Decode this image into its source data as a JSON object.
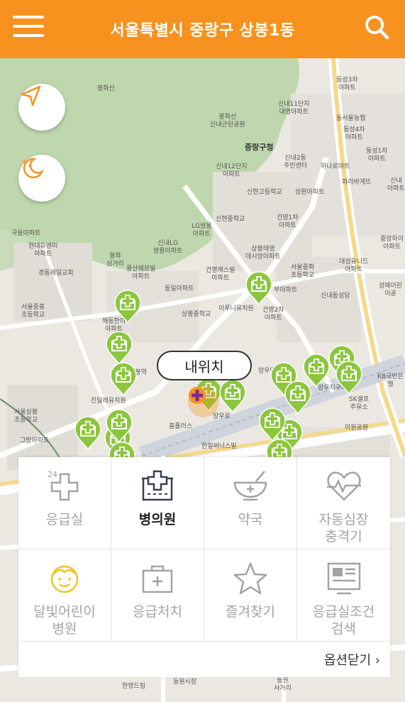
{
  "header": {
    "title": "서울특별시 중랑구 상봉1동",
    "accent": "#f7921e"
  },
  "map": {
    "my_location_label": "내위치",
    "labels": [
      "봉화산",
      "봉화산\n신내근린공원",
      "중랑구청",
      "동성3차\n아파트",
      "신내11단지\n대명아파트",
      "동서울농협",
      "동성4차\n아파트",
      "동성1차\n아파트",
      "신내2동\n주민센터",
      "신내12단지\n아파트",
      "신현고등학교",
      "성원아파트",
      "하나로마트",
      "파리바게뜨",
      "신내\n아파트",
      "LG쌍용\n아파트",
      "신현중학교",
      "건영1차\n아파트",
      "극동아파트",
      "현대휴엔미\n아파트",
      "신내LG\n쌍용아파트",
      "상봉태영\n데시앙아파트",
      "중앙하이\n아파트",
      "경동제일교회",
      "봉화\n삼거리",
      "풍산쉐르빌\n아파트",
      "건영캐스빌\n아파트",
      "서울중화\n초등학교",
      "대성유니드\n아파트",
      "성예어린이공",
      "동일아파트",
      "서울중흥\n초등학교",
      "해동한미\n아파트",
      "상봉중학교",
      "이루니유치원",
      "건영2차\n아파트",
      "부아파트",
      "신내동성당",
      "상봉역",
      "망우역",
      "KB국민은행",
      "망우지구대",
      "SK셀프\n주유소",
      "진달래유치원",
      "서울상봉\n초등학교",
      "그랑아파트",
      "홈플러스",
      "한일써너스빌",
      "미원공원",
      "망우로",
      "한영드림",
      "동원시장",
      "동원\n사거리"
    ]
  },
  "buttons": {
    "navigate": "navigate-icon",
    "night_mode": "night-mode-icon"
  },
  "panel": {
    "items": [
      {
        "label": "응급실",
        "icon": "24-hour-cross-icon",
        "active": false
      },
      {
        "label": "병의원",
        "icon": "hospital-icon",
        "active": true
      },
      {
        "label": "약국",
        "icon": "pharmacy-bowl-icon",
        "active": false
      },
      {
        "label": "자동심장\n충격기",
        "icon": "heart-pulse-icon",
        "active": false
      },
      {
        "label": "달빛어린이\n병원",
        "icon": "child-face-icon",
        "active": false
      },
      {
        "label": "응급처치",
        "icon": "first-aid-kit-icon",
        "active": false
      },
      {
        "label": "즐겨찾기",
        "icon": "star-icon",
        "active": false
      },
      {
        "label": "응급실조건\n검색",
        "icon": "er-condition-search-icon",
        "active": false
      }
    ],
    "close_label": "옵션닫기 ›"
  }
}
